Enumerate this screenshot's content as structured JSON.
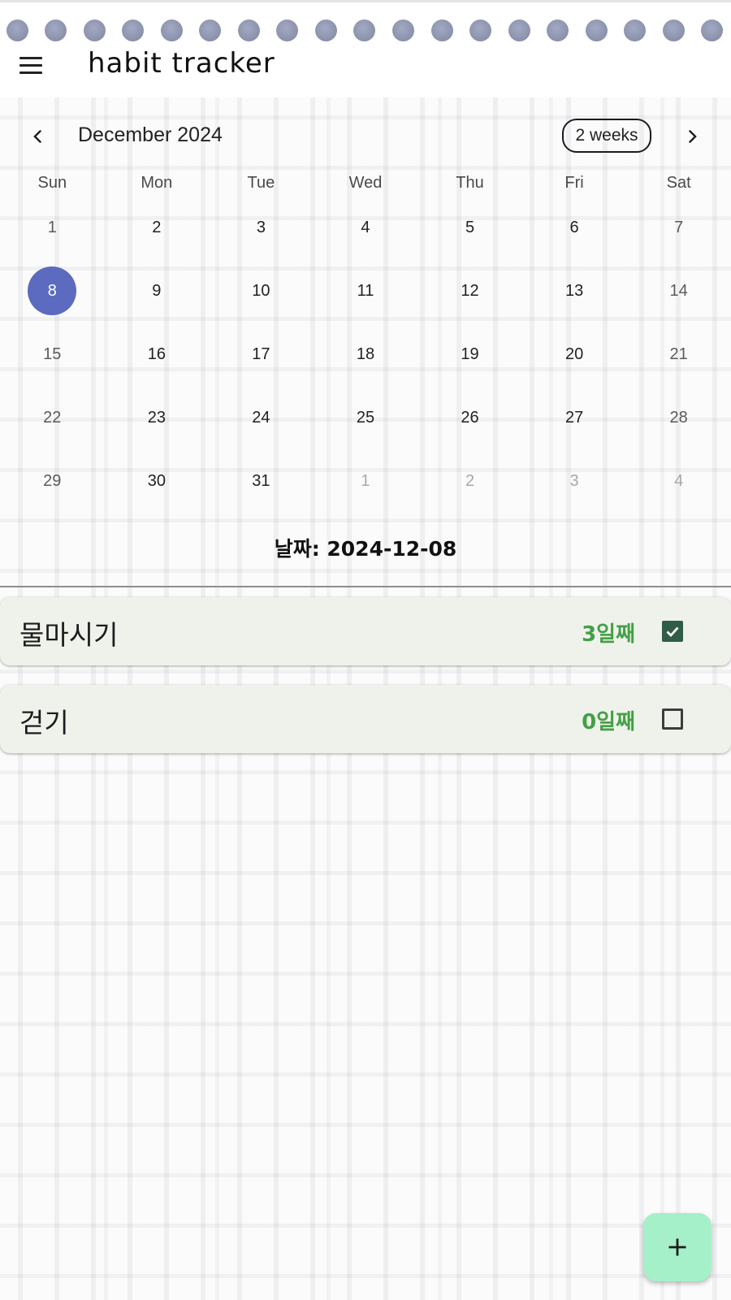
{
  "app": {
    "title": "habit tracker"
  },
  "calendar": {
    "month_label": "December 2024",
    "format_button": "2 weeks",
    "weekdays": [
      "Sun",
      "Mon",
      "Tue",
      "Wed",
      "Thu",
      "Fri",
      "Sat"
    ],
    "weeks": [
      [
        "1",
        "2",
        "3",
        "4",
        "5",
        "6",
        "7"
      ],
      [
        "8",
        "9",
        "10",
        "11",
        "12",
        "13",
        "14"
      ],
      [
        "15",
        "16",
        "17",
        "18",
        "19",
        "20",
        "21"
      ],
      [
        "22",
        "23",
        "24",
        "25",
        "26",
        "27",
        "28"
      ],
      [
        "29",
        "30",
        "31",
        "1",
        "2",
        "3",
        "4"
      ]
    ],
    "selected_day": "8"
  },
  "date_line": "날짜: 2024-12-08",
  "habits": [
    {
      "name": "물마시기",
      "streak": "3일째",
      "checked": true
    },
    {
      "name": "걷기",
      "streak": "0일째",
      "checked": false
    }
  ],
  "icons": {
    "menu": "menu-icon",
    "prev": "chevron-left-icon",
    "next": "chevron-right-icon",
    "check": "check-icon",
    "add": "plus-icon"
  },
  "colors": {
    "selected_day": "#5c6bc0",
    "streak": "#43a047",
    "checkbox_checked": "#2f5d47",
    "card": "#eff2ea",
    "fab": "#a5f0c8"
  }
}
